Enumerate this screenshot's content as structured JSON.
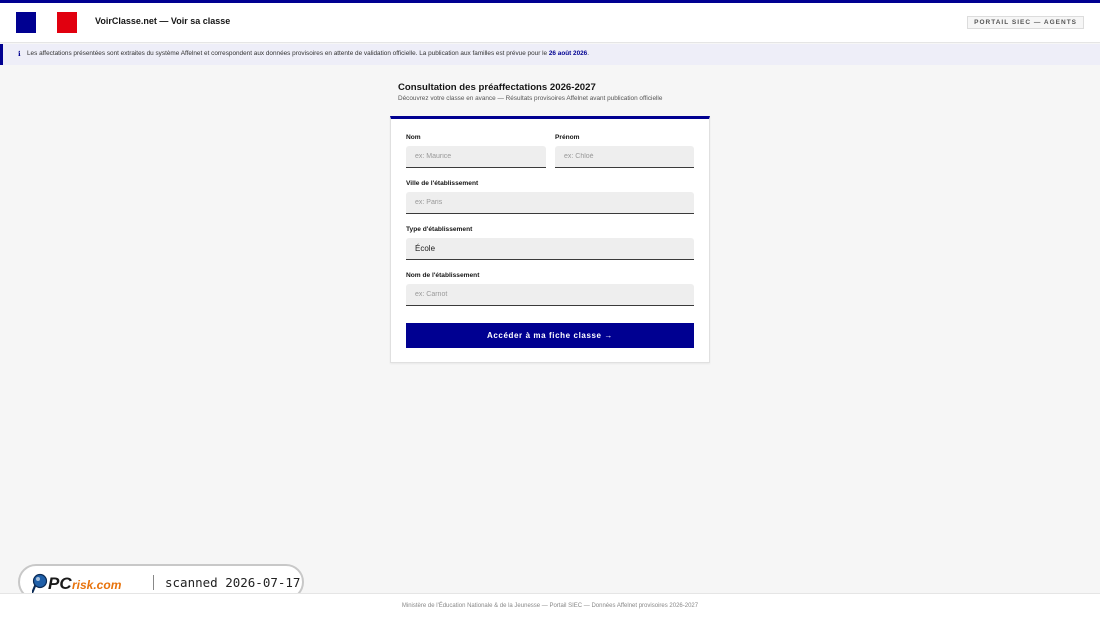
{
  "header": {
    "site_title": "VoirClasse.net — Voir sa classe",
    "portal_button": "PORTAIL SIEC — AGENTS"
  },
  "notice": {
    "icon": "info-icon",
    "icon_glyph": "ℹ",
    "text": "Les affectations présentées sont extraites du système Affelnet et correspondent aux données provisoires en attente de validation officielle. La publication aux familles est prévue pour le",
    "date": "26 août 2026",
    "suffix": "."
  },
  "main": {
    "title": "Consultation des préaffectations 2026-2027",
    "subtitle": "Découvrez votre classe en avance — Résultats provisoires Affelnet avant publication officielle"
  },
  "form": {
    "nom": {
      "label": "Nom",
      "placeholder": "ex: Maurice"
    },
    "prenom": {
      "label": "Prénom",
      "placeholder": "ex: Chloé"
    },
    "ville": {
      "label": "Ville de l'établissement",
      "placeholder": "ex: Paris"
    },
    "type": {
      "label": "Type d'établissement",
      "value": "École"
    },
    "etab": {
      "label": "Nom de l'établissement",
      "placeholder": "ex: Carnot"
    },
    "submit_label": "Accéder à ma fiche classe →"
  },
  "watermark": {
    "logo_text_pc": "PC",
    "logo_text_risk": "risk.com",
    "scan_text": "scanned 2026-07-17"
  },
  "footer": {
    "text": "Ministère de l'Éducation Nationale & de la Jeunesse — Portail SIEC — Données Affelnet provisoires 2026-2027"
  },
  "colors": {
    "primary": "#000091",
    "flag_red": "#e1000f",
    "background": "#f6f6f6"
  }
}
